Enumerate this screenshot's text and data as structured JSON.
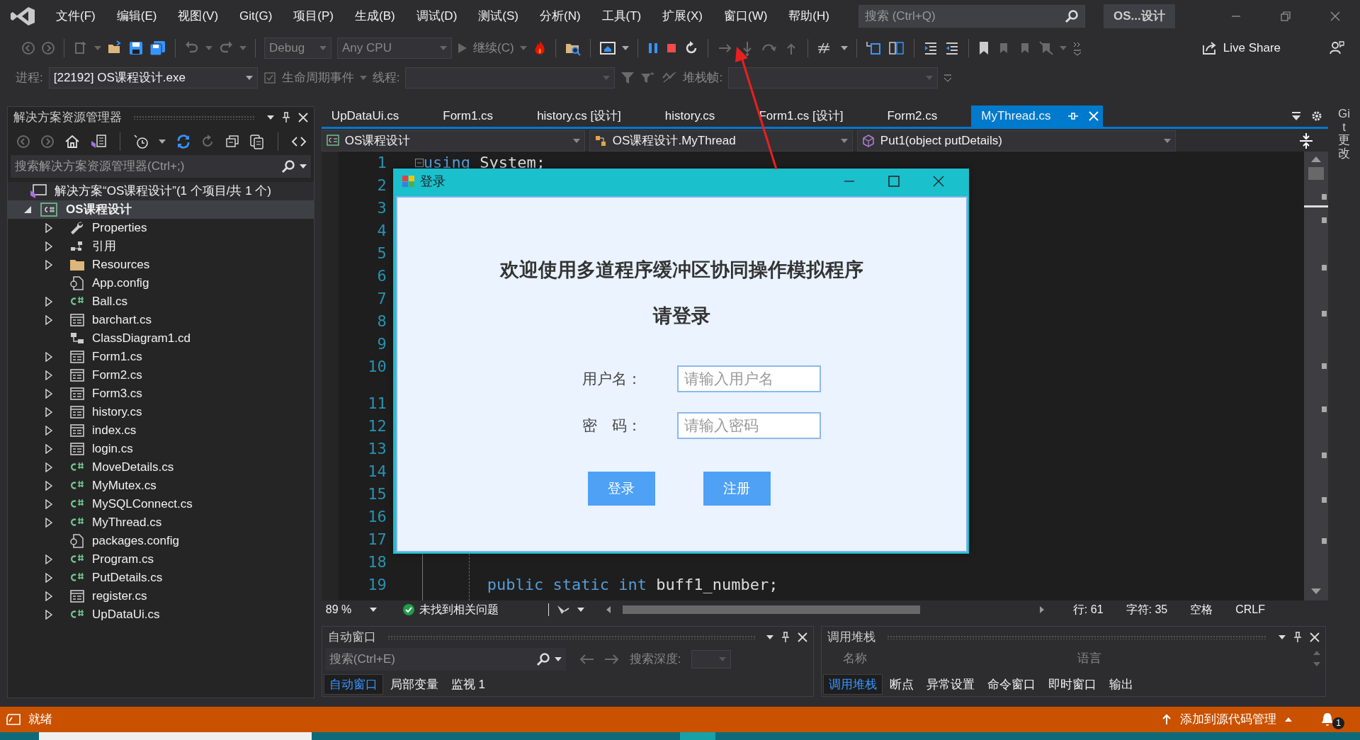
{
  "menu": [
    "文件(F)",
    "编辑(E)",
    "视图(V)",
    "Git(G)",
    "项目(P)",
    "生成(B)",
    "调试(D)",
    "测试(S)",
    "分析(N)",
    "工具(T)",
    "扩展(X)",
    "窗口(W)",
    "帮助(H)"
  ],
  "search": {
    "placeholder": "搜索 (Ctrl+Q)"
  },
  "solution_badge": "OS...设计",
  "toolbar": {
    "configuration": "Debug",
    "platform": "Any CPU",
    "continue": "继续(C)",
    "live_share": "Live Share"
  },
  "debug_bar": {
    "process_label": "进程:",
    "process": "[22192] OS课程设计.exe",
    "lifecycle": "生命周期事件",
    "thread_label": "线程:",
    "frame_label": "堆栈帧:"
  },
  "solution_explorer": {
    "title": "解决方案资源管理器",
    "search": {
      "placeholder": "搜索解决方案资源管理器(Ctrl+;)"
    },
    "solution": "解决方案“OS课程设计”(1 个项目/共 1 个)",
    "project": {
      "name": "OS课程设计",
      "expanded": true,
      "children": [
        {
          "name": "Properties",
          "kind": "wrench",
          "expandable": true
        },
        {
          "name": "引用",
          "kind": "references",
          "expandable": true
        },
        {
          "name": "Resources",
          "kind": "folder",
          "expandable": true
        },
        {
          "name": "App.config",
          "kind": "config",
          "expandable": false
        },
        {
          "name": "Ball.cs",
          "kind": "csharp",
          "expandable": true
        },
        {
          "name": "barchart.cs",
          "kind": "form",
          "expandable": true
        },
        {
          "name": "ClassDiagram1.cd",
          "kind": "diagram",
          "expandable": false
        },
        {
          "name": "Form1.cs",
          "kind": "form",
          "expandable": true
        },
        {
          "name": "Form2.cs",
          "kind": "form",
          "expandable": true
        },
        {
          "name": "Form3.cs",
          "kind": "form",
          "expandable": true
        },
        {
          "name": "history.cs",
          "kind": "form",
          "expandable": true
        },
        {
          "name": "index.cs",
          "kind": "form",
          "expandable": true
        },
        {
          "name": "login.cs",
          "kind": "form",
          "expandable": true
        },
        {
          "name": "MoveDetails.cs",
          "kind": "csharp",
          "expandable": true
        },
        {
          "name": "MyMutex.cs",
          "kind": "csharp",
          "expandable": true
        },
        {
          "name": "MySQLConnect.cs",
          "kind": "csharp",
          "expandable": true
        },
        {
          "name": "MyThread.cs",
          "kind": "csharp",
          "expandable": true
        },
        {
          "name": "packages.config",
          "kind": "config",
          "expandable": false
        },
        {
          "name": "Program.cs",
          "kind": "csharp",
          "expandable": true
        },
        {
          "name": "PutDetails.cs",
          "kind": "csharp",
          "expandable": true
        },
        {
          "name": "register.cs",
          "kind": "form",
          "expandable": true
        },
        {
          "name": "UpDataUi.cs",
          "kind": "csharp",
          "expandable": true
        }
      ]
    }
  },
  "editor": {
    "tabs": [
      {
        "label": "UpDataUi.cs",
        "selected": false
      },
      {
        "label": "Form1.cs",
        "selected": false
      },
      {
        "label": "history.cs [设计]",
        "selected": false
      },
      {
        "label": "history.cs",
        "selected": false
      },
      {
        "label": "Form1.cs [设计]",
        "selected": false
      },
      {
        "label": "Form2.cs",
        "selected": false
      },
      {
        "label": "MyThread.cs",
        "selected": true
      }
    ],
    "nav": [
      {
        "text": "OS课程设计",
        "kind": "project"
      },
      {
        "text": "OS课程设计.MyThread",
        "kind": "class"
      },
      {
        "text": "Put1(object putDetails)",
        "kind": "method"
      }
    ],
    "lines": [
      {
        "number": "1",
        "tokens": [
          {
            "text": "using",
            "kind": "keyword"
          },
          {
            "text": " System;",
            "kind": "plain"
          }
        ]
      },
      {
        "number": "2"
      },
      {
        "number": "3"
      },
      {
        "number": "4"
      },
      {
        "number": "5"
      },
      {
        "number": "6"
      },
      {
        "number": "7"
      },
      {
        "number": "8"
      },
      {
        "number": "9"
      },
      {
        "number": "10"
      },
      {
        "number": "11"
      },
      {
        "number": "12"
      },
      {
        "number": "13"
      },
      {
        "number": "14"
      },
      {
        "number": "15"
      },
      {
        "number": "16"
      },
      {
        "number": "17"
      },
      {
        "number": "18"
      },
      {
        "number": "19",
        "tokens": [
          {
            "text": "public static int",
            "kind": "keyword"
          },
          {
            "text": " buff1_number;",
            "kind": "plain"
          }
        ]
      }
    ],
    "zoom": "89 %",
    "issues": "未找到相关问题",
    "position": [
      "行: 61",
      "字符: 35",
      "空格",
      "CRLF"
    ]
  },
  "dialog": {
    "title": "登录",
    "heading": "欢迎使用多道程序缓冲区协同操作模拟程序",
    "subheading": "请登录",
    "fields": [
      {
        "label": "用户名：",
        "placeholder": "请输入用户名"
      },
      {
        "label": "密　码：",
        "placeholder": "请输入密码"
      }
    ],
    "buttons": [
      "登录",
      "注册"
    ]
  },
  "autos_panel": {
    "title": "自动窗口",
    "search": {
      "placeholder": "搜索(Ctrl+E)"
    },
    "depth_label": "搜索深度:",
    "tabs": [
      {
        "label": "自动窗口",
        "selected": true
      },
      {
        "label": "局部变量",
        "selected": false
      },
      {
        "label": "监视 1",
        "selected": false
      }
    ]
  },
  "callstack_panel": {
    "title": "调用堆栈",
    "columns": [
      "名称",
      "语言"
    ],
    "tabs": [
      {
        "label": "调用堆栈",
        "selected": true
      },
      {
        "label": "断点",
        "selected": false
      },
      {
        "label": "异常设置",
        "selected": false
      },
      {
        "label": "命令窗口",
        "selected": false
      },
      {
        "label": "即时窗口",
        "selected": false
      },
      {
        "label": "输出",
        "selected": false
      }
    ]
  },
  "side_tab": "Git 更改",
  "status_bar": {
    "text": "就绪",
    "source_control": "添加到源代码管理",
    "notifications": "1"
  }
}
